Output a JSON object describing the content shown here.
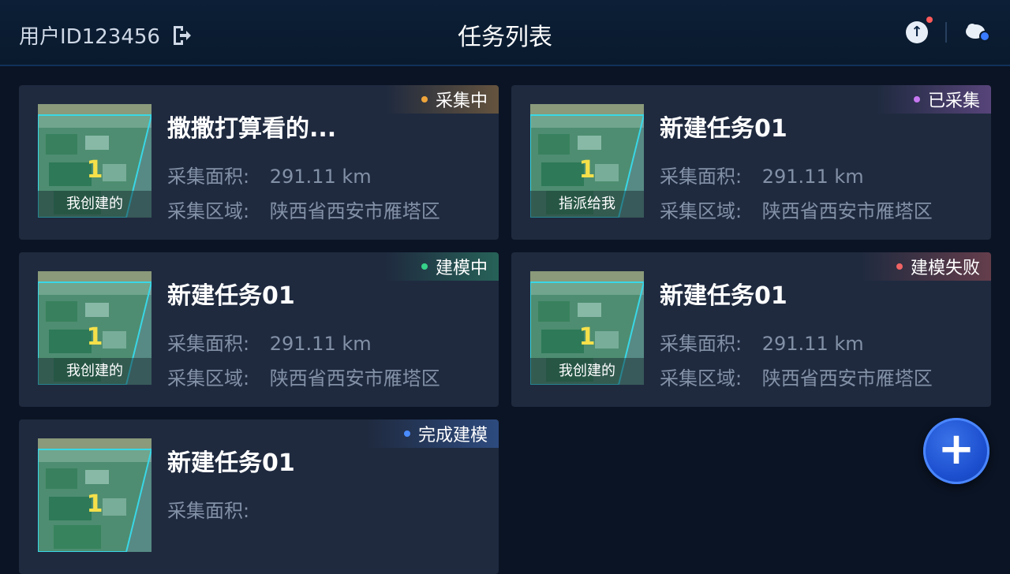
{
  "header": {
    "user_label": "用户ID123456",
    "title": "任务列表",
    "icons": [
      "logout-icon",
      "upload-icon",
      "cloud-icon"
    ]
  },
  "tasks": [
    {
      "title": "撒撒打算看的...",
      "area_label": "采集面积:",
      "area_value": "291.11 km",
      "region_label": "采集区域:",
      "region_value": "陕西省西安市雁塔区",
      "status": "采集中",
      "status_color": "#f0a53a",
      "thumb_number": "1",
      "thumb_tag": "我创建的"
    },
    {
      "title": "新建任务01",
      "area_label": "采集面积:",
      "area_value": "291.11 km",
      "region_label": "采集区域:",
      "region_value": "陕西省西安市雁塔区",
      "status": "已采集",
      "status_color": "#c778f0",
      "thumb_number": "1",
      "thumb_tag": "指派给我"
    },
    {
      "title": "新建任务01",
      "area_label": "采集面积:",
      "area_value": "291.11 km",
      "region_label": "采集区域:",
      "region_value": "陕西省西安市雁塔区",
      "status": "建模中",
      "status_color": "#36d28a",
      "thumb_number": "1",
      "thumb_tag": "我创建的"
    },
    {
      "title": "新建任务01",
      "area_label": "采集面积:",
      "area_value": "291.11 km",
      "region_label": "采集区域:",
      "region_value": "陕西省西安市雁塔区",
      "status": "建模失败",
      "status_color": "#f06464",
      "thumb_number": "1",
      "thumb_tag": "我创建的"
    },
    {
      "title": "新建任务01",
      "area_label": "采集面积:",
      "area_value": "",
      "region_label": "",
      "region_value": "",
      "status": "完成建模",
      "status_color": "#4a8cff",
      "thumb_number": "1",
      "thumb_tag": ""
    }
  ],
  "fab": {
    "label": "+",
    "icon": "plus-icon"
  }
}
